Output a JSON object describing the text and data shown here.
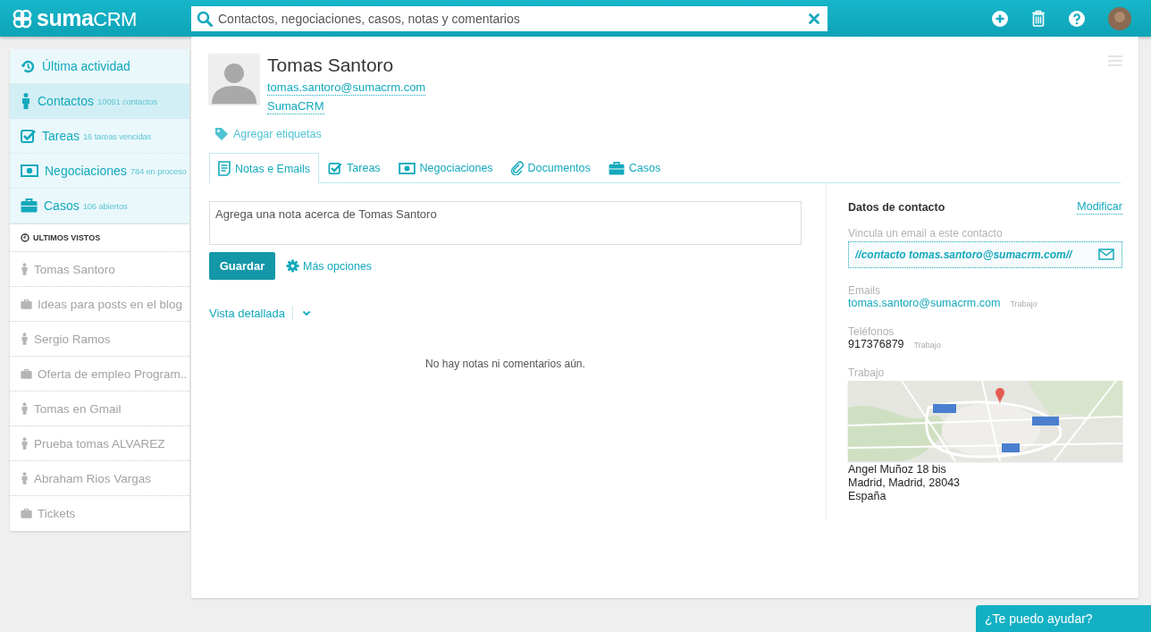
{
  "header": {
    "logo": "**suma**CRM",
    "search": {
      "placeholder": "Contactos, negociaciones, casos, notas y comentarios"
    }
  },
  "sidebar": {
    "nav": [
      {
        "kind": "activity",
        "label": "Última actividad",
        "selected": false
      },
      {
        "kind": "contact",
        "label": "Contactos",
        "count": "10091 contactos",
        "selected": true
      },
      {
        "kind": "task",
        "label": "Tareas",
        "count": "16 tareas vencidas",
        "selected": false
      },
      {
        "kind": "deal",
        "label": "Negociaciones",
        "count": "784 en proceso",
        "selected": false
      },
      {
        "kind": "case",
        "label": "Casos",
        "count": "106 abiertos",
        "selected": false
      }
    ],
    "recent_title": "ULTIMOS VISTOS",
    "recent": [
      {
        "kind": "contact",
        "label": "Tomas Santoro"
      },
      {
        "kind": "case",
        "label": "Ideas para posts en el blog"
      },
      {
        "kind": "contact",
        "label": "Sergio Ramos"
      },
      {
        "kind": "case",
        "label": "Oferta de empleo Program.."
      },
      {
        "kind": "contact",
        "label": "Tomas en Gmail"
      },
      {
        "kind": "contact",
        "label": "Prueba tomas ALVAREZ"
      },
      {
        "kind": "contact",
        "label": "Abraham Rios Vargas"
      },
      {
        "kind": "case",
        "label": "Tickets"
      }
    ]
  },
  "contact": {
    "name": "Tomas Santoro",
    "email": "tomas.santoro@sumacrm.com",
    "company": "SumaCRM",
    "tags_link": "Agregar etiquetas"
  },
  "tabs": [
    {
      "kind": "note",
      "label": "Notas e Emails",
      "selected": true
    },
    {
      "kind": "task",
      "label": "Tareas",
      "selected": false
    },
    {
      "kind": "deal",
      "label": "Negociaciones",
      "selected": false
    },
    {
      "kind": "doc",
      "label": "Documentos",
      "selected": false
    },
    {
      "kind": "case",
      "label": "Casos",
      "selected": false
    }
  ],
  "note": {
    "placeholder": "Agrega una nota acerca de Tomas Santoro",
    "save": "Guardar",
    "more": "Más opciones"
  },
  "view": "Vista detallada",
  "empty": "No hay notas ni comentarios aún.",
  "details": {
    "title": "Datos de contacto",
    "edit": "Modificar",
    "link_label": "Vincula un email a este contacto",
    "link_value": "//contacto tomas.santoro@sumacrm.com//",
    "emails_label": "Emails",
    "emails": [
      {
        "value": "tomas.santoro@sumacrm.com",
        "type": "Trabajo"
      }
    ],
    "phones_label": "Teléfonos",
    "phones": [
      {
        "value": "917376879",
        "type": "Trabajo"
      }
    ],
    "address_label": "Trabajo",
    "address": [
      "Angel Muñoz 18 bis",
      "Madrid, Madrid, 28043",
      "España"
    ]
  },
  "help": "¿Te puedo ayudar?"
}
